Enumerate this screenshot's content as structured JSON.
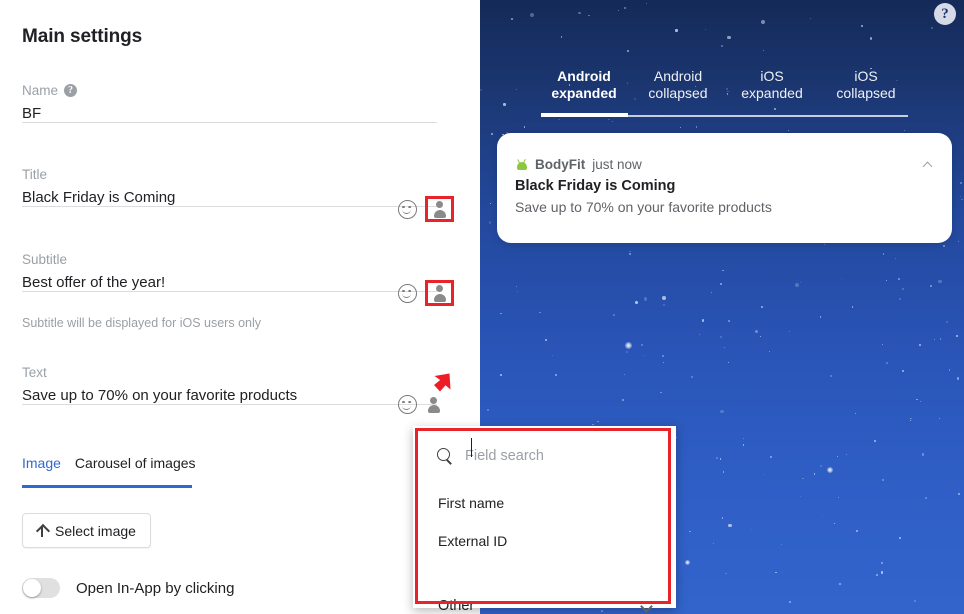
{
  "left": {
    "page_title": "Main settings",
    "fields": [
      {
        "label": "Name",
        "value": "BF",
        "help": "?",
        "hint": ""
      },
      {
        "label": "Title",
        "value": "Black Friday is Coming",
        "help": null,
        "hint": ""
      },
      {
        "label": "Subtitle",
        "value": "Best offer of the year!",
        "help": null,
        "hint": "Subtitle will be displayed for iOS users only"
      },
      {
        "label": "Text",
        "value": "Save up to 70% on your favorite products",
        "help": null,
        "hint": ""
      }
    ],
    "image_tabs": [
      {
        "label": "Image",
        "active": true
      },
      {
        "label": "Carousel of images",
        "active": false
      }
    ],
    "select_image_label": "Select image",
    "toggle": {
      "label": "Open In-App by clicking",
      "on": false
    }
  },
  "dropdown": {
    "search_placeholder": "Field search",
    "search_value": "",
    "items": [
      "First name",
      "External ID"
    ],
    "other_label": "Other"
  },
  "preview": {
    "help_label": "?",
    "tabs": [
      {
        "line1": "Android",
        "line2": "expanded",
        "active": true
      },
      {
        "line1": "Android",
        "line2": "collapsed",
        "active": false
      },
      {
        "line1": "iOS",
        "line2": "expanded",
        "active": false
      },
      {
        "line1": "iOS",
        "line2": "collapsed",
        "active": false
      }
    ],
    "notification": {
      "app_name": "BodyFit",
      "time": "just now",
      "title": "Black Friday is Coming",
      "text": "Save up to 70% on your favorite products"
    }
  },
  "colors": {
    "accent_blue": "#2f6ad1",
    "highlight_red": "#e8232a",
    "android_green": "#8dc63f",
    "preview_bg_top": "#142a58",
    "preview_bg_bottom": "#3264cc"
  }
}
